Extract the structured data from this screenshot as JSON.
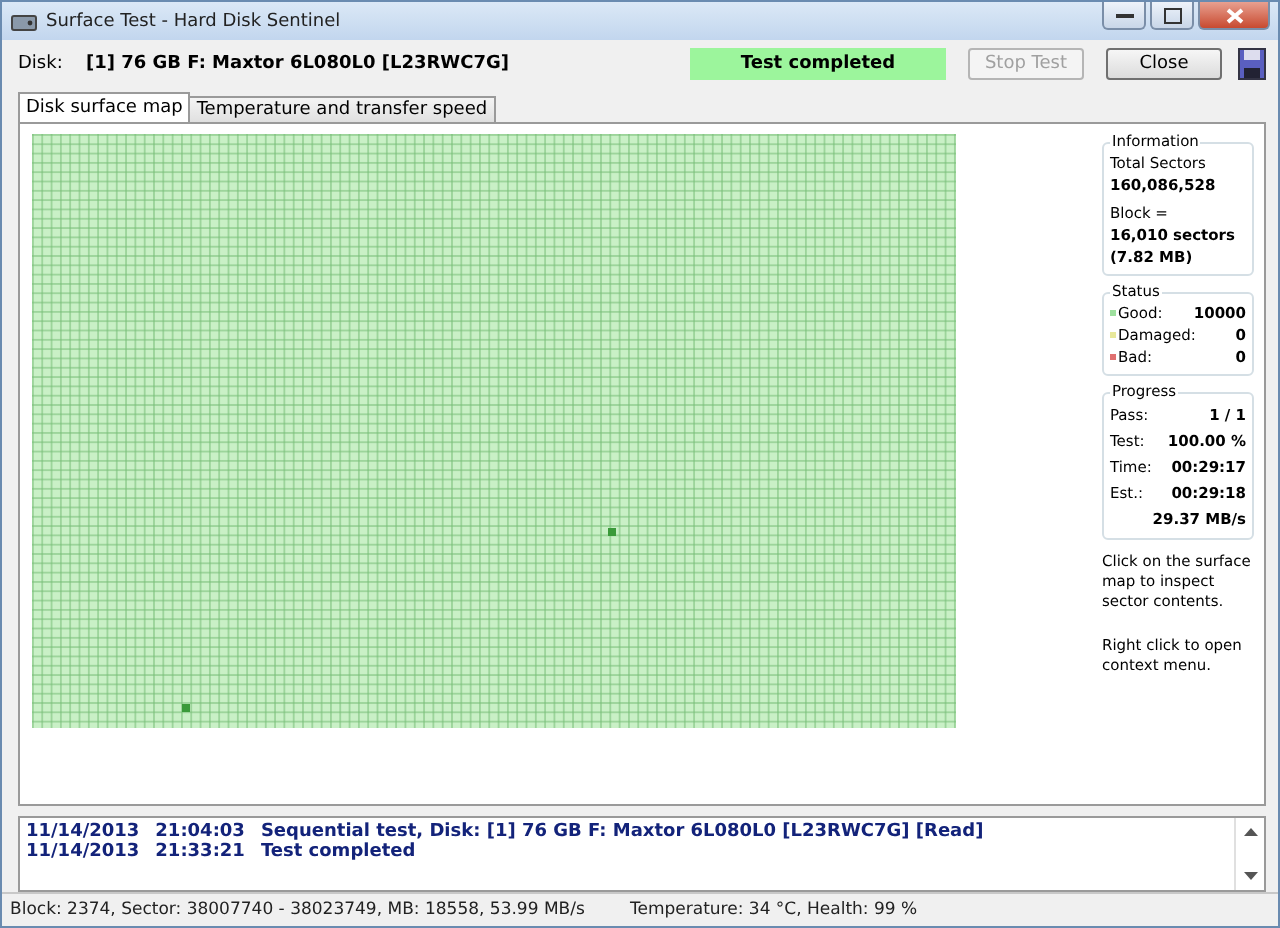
{
  "window": {
    "title": "Surface Test - Hard Disk Sentinel"
  },
  "disk": {
    "label": "Disk:",
    "value": "[1] 76 GB F: Maxtor 6L080L0 [L23RWC7G]"
  },
  "status_message": "Test completed",
  "buttons": [
    {
      "label": "Stop Test",
      "disabled": true
    },
    {
      "label": "Close",
      "disabled": false
    }
  ],
  "tabs": [
    {
      "label": "Disk surface map",
      "selected": true
    },
    {
      "label": "Temperature and transfer speed",
      "selected": false
    }
  ],
  "information": {
    "title": "Information",
    "lines": [
      {
        "text": "Total Sectors",
        "bold": false
      },
      {
        "text": "160,086,528",
        "bold": true
      },
      {
        "text": "Block =",
        "bold": false
      },
      {
        "text": "16,010 sectors",
        "bold": true
      },
      {
        "text": "(7.82 MB)",
        "bold": true
      }
    ]
  },
  "status": {
    "title": "Status",
    "items": [
      {
        "label": "Good:",
        "value": "10000",
        "color": "#9ee09e"
      },
      {
        "label": "Damaged:",
        "value": "0",
        "color": "#e8e89a"
      },
      {
        "label": "Bad:",
        "value": "0",
        "color": "#e07070"
      }
    ]
  },
  "progress": {
    "title": "Progress",
    "rows": [
      {
        "label": "Pass:",
        "value": "1 / 1"
      },
      {
        "label": "Test:",
        "value": "100.00 %"
      },
      {
        "label": "Time:",
        "value": "00:29:17"
      },
      {
        "label": "Est.:",
        "value": "00:29:18"
      },
      {
        "value": "29.37 MB/s"
      }
    ]
  },
  "hints": [
    "Click on the surface map to inspect sector contents.",
    "Right click to open context menu."
  ],
  "log": [
    {
      "date": "11/14/2013",
      "time": "21:04:03",
      "message": "Sequential test, Disk: [1] 76 GB F: Maxtor 6L080L0 [L23RWC7G] [Read]"
    },
    {
      "date": "11/14/2013",
      "time": "21:33:21",
      "message": "Test completed"
    }
  ],
  "status_bar": {
    "left": "Block: 2374, Sector: 38007740 - 38023749, MB: 18558, 53.99 MB/s",
    "right": "Temperature: 34  °C,  Health: 99 %"
  }
}
